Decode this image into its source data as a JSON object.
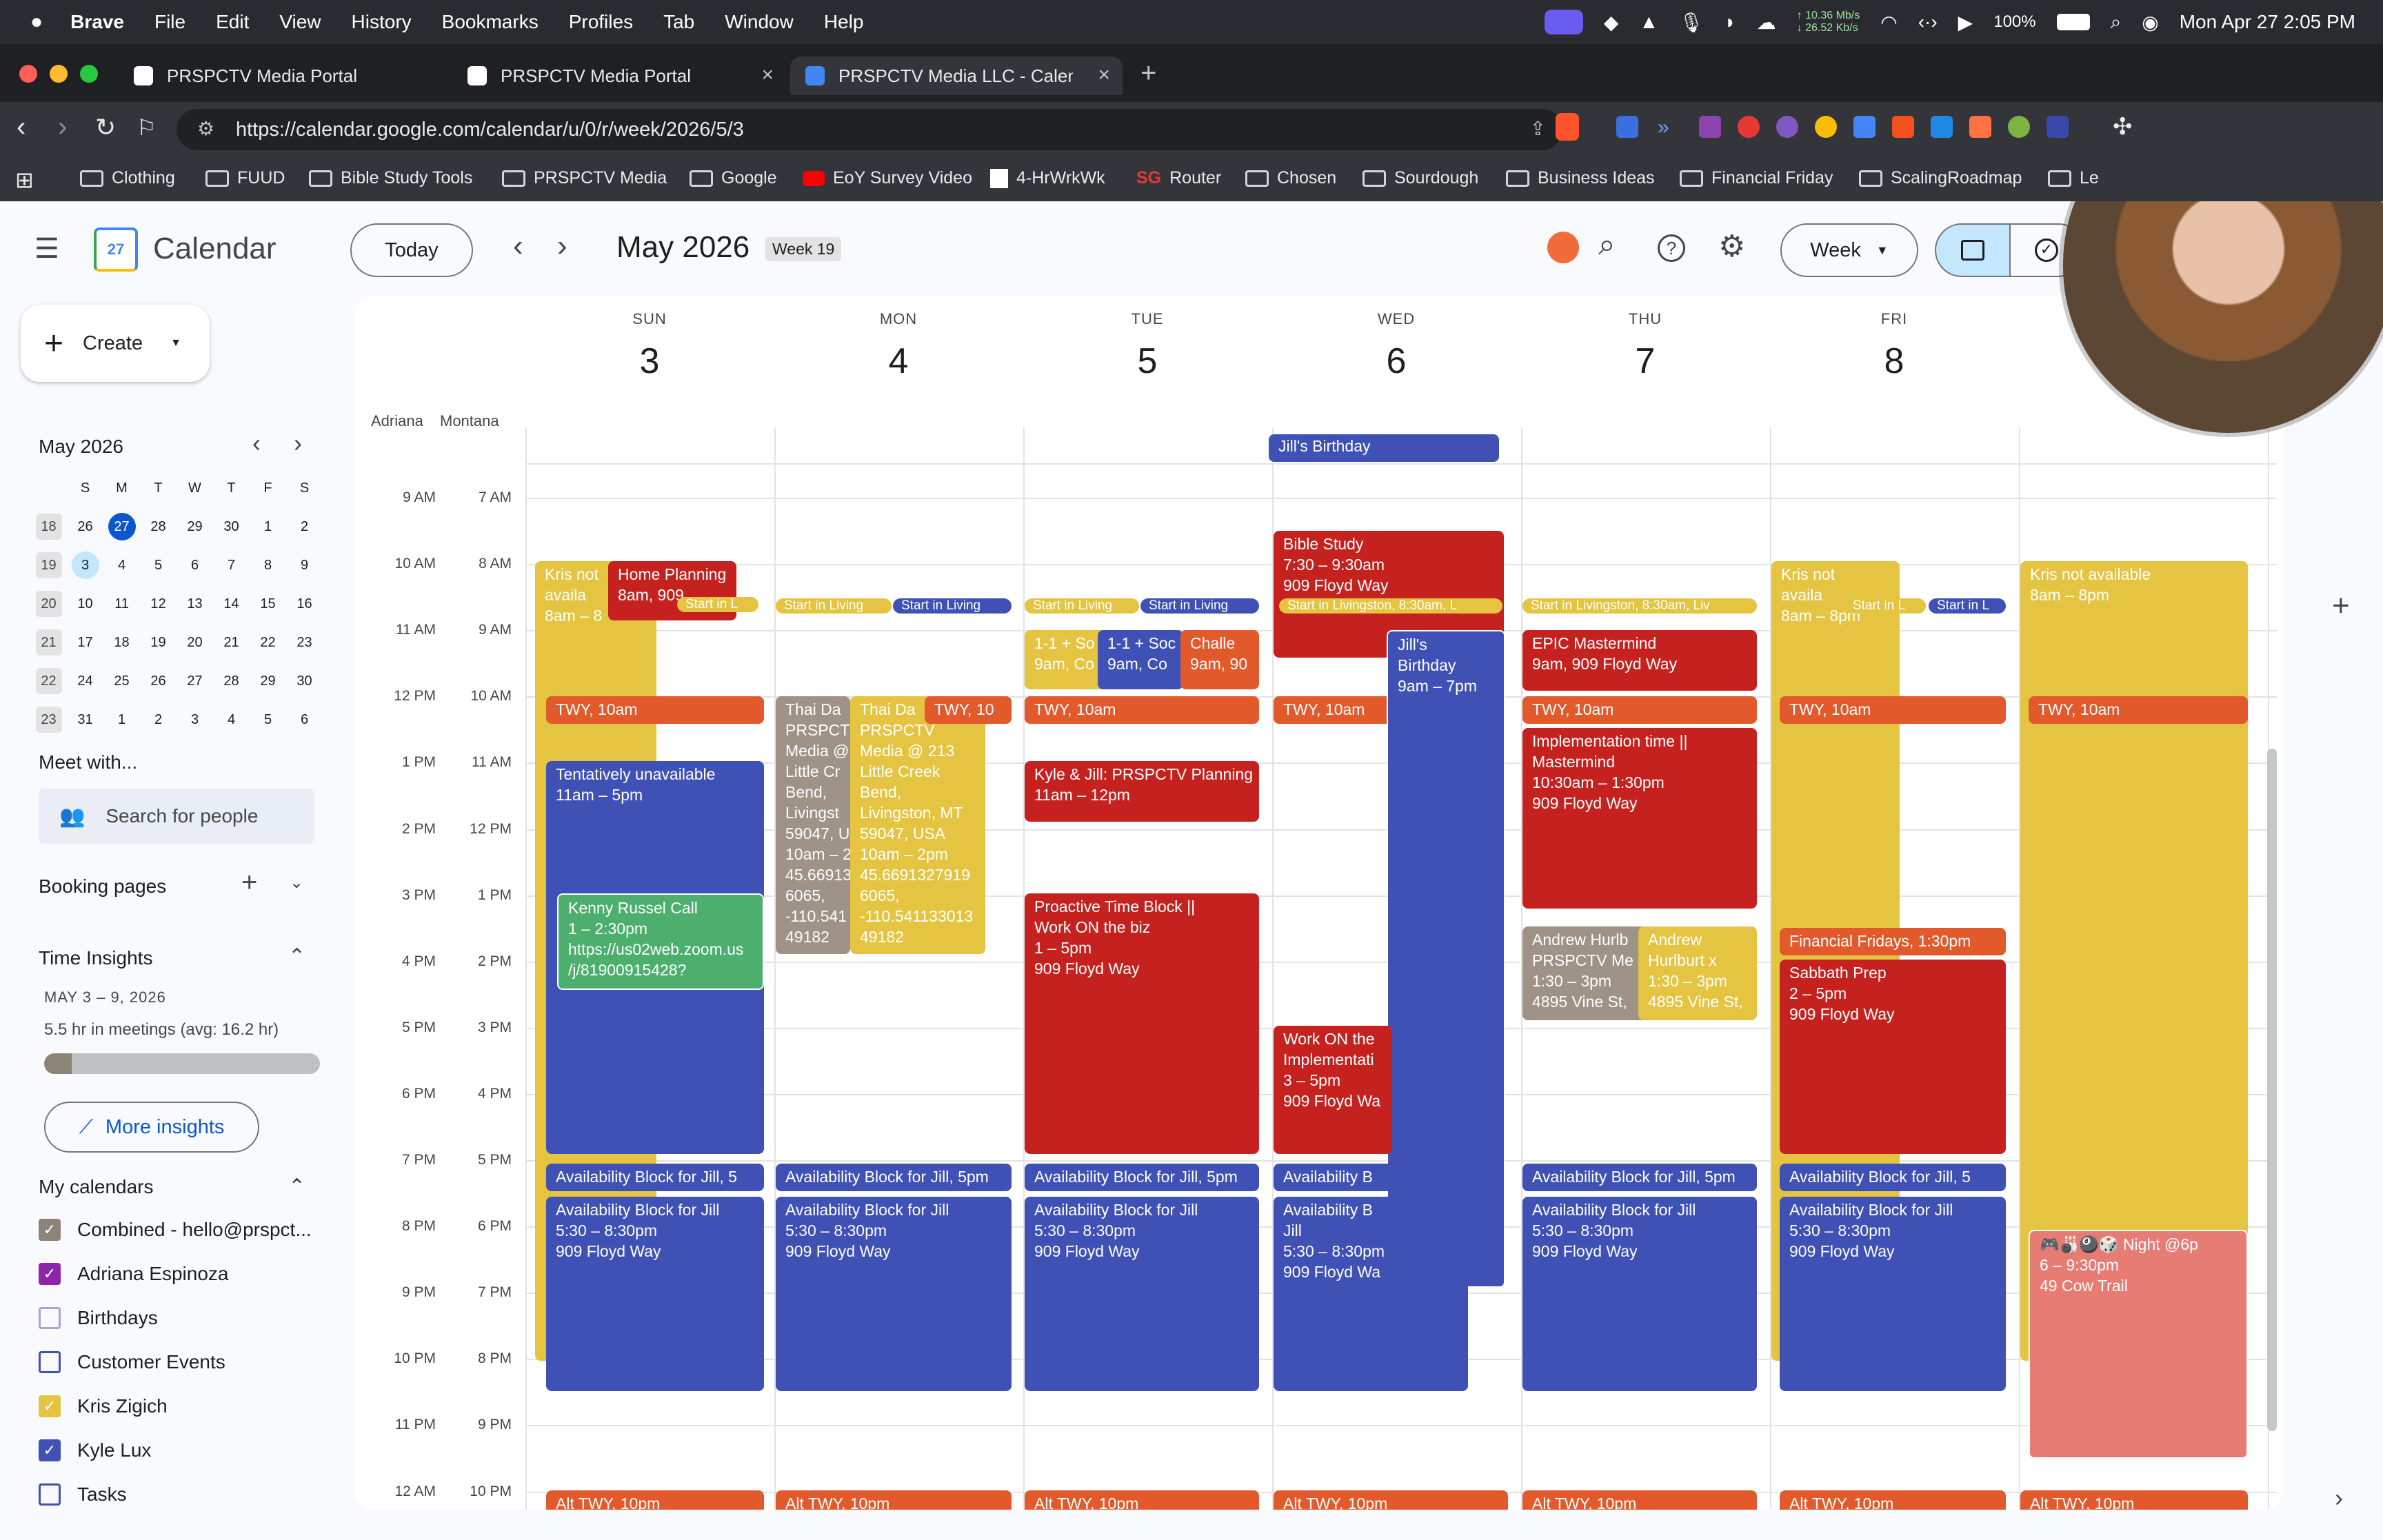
{
  "menubar": {
    "app": "Brave",
    "items": [
      "File",
      "Edit",
      "View",
      "History",
      "Bookmarks",
      "Profiles",
      "Tab",
      "Window",
      "Help"
    ],
    "net_up": "↑ 10.36 Mb/s",
    "net_down": "↓ 26.52 Kb/s",
    "battery": "100%",
    "clock": "Mon Apr 27  2:05 PM"
  },
  "tabs": [
    {
      "title": "PRSPCTV Media Portal"
    },
    {
      "title": "PRSPCTV Media Portal",
      "close": "×"
    },
    {
      "title": "PRSPCTV Media LLC - Calendar",
      "close": "×"
    }
  ],
  "newtab": "+",
  "url": "https://calendar.google.com/calendar/u/0/r/week/2026/5/3",
  "bookmarks": [
    "Clothing",
    "FUUD",
    "Bible Study Tools",
    "PRSPCTV Media",
    "Google",
    "EoY Survey Video",
    "4-HrWrkWk",
    "Router",
    "Chosen",
    "Sourdough",
    "Business Ideas",
    "Financial Friday",
    "ScalingRoadmap",
    "Le"
  ],
  "header": {
    "app_name": "Calendar",
    "logo_day": "27",
    "today": "Today",
    "month": "May 2026",
    "week_badge": "Week 19",
    "view": "Week"
  },
  "sidebar": {
    "create": "Create",
    "mini_month": "May 2026",
    "mini_dow": [
      "S",
      "M",
      "T",
      "W",
      "T",
      "F",
      "S"
    ],
    "mini_rows": [
      {
        "wk": "18",
        "days": [
          "26",
          "27",
          "28",
          "29",
          "30",
          "1",
          "2"
        ]
      },
      {
        "wk": "19",
        "days": [
          "3",
          "4",
          "5",
          "6",
          "7",
          "8",
          "9"
        ]
      },
      {
        "wk": "20",
        "days": [
          "10",
          "11",
          "12",
          "13",
          "14",
          "15",
          "16"
        ]
      },
      {
        "wk": "21",
        "days": [
          "17",
          "18",
          "19",
          "20",
          "21",
          "22",
          "23"
        ]
      },
      {
        "wk": "22",
        "days": [
          "24",
          "25",
          "26",
          "27",
          "28",
          "29",
          "30"
        ]
      },
      {
        "wk": "23",
        "days": [
          "31",
          "1",
          "2",
          "3",
          "4",
          "5",
          "6"
        ]
      }
    ],
    "meet_with": "Meet with...",
    "search_people": "Search for people",
    "booking_pages": "Booking pages",
    "time_insights": "Time Insights",
    "insights_range": "MAY 3 – 9, 2026",
    "insights_summary": "5.5 hr in meetings (avg: 16.2 hr)",
    "insights_fill": 0.1,
    "more_insights": "More insights",
    "my_calendars": "My calendars",
    "calendars": [
      {
        "name": "Combined - hello@prspct...",
        "color": "#8d8478",
        "checked": true
      },
      {
        "name": "Adriana Espinoza",
        "color": "#8e24aa",
        "checked": true
      },
      {
        "name": "Birthdays",
        "color": "#b39ddb",
        "checked": false
      },
      {
        "name": "Customer Events",
        "color": "#3f51b5",
        "checked": false
      },
      {
        "name": "Kris Zigich",
        "color": "#e4c441",
        "checked": true
      },
      {
        "name": "Kyle Lux",
        "color": "#3f51b5",
        "checked": true
      },
      {
        "name": "Tasks",
        "color": "#3f51b5",
        "checked": false
      }
    ]
  },
  "timezones": [
    "Adriana",
    "Montana"
  ],
  "days": [
    {
      "name": "SUN",
      "num": "3"
    },
    {
      "name": "MON",
      "num": "4"
    },
    {
      "name": "TUE",
      "num": "5"
    },
    {
      "name": "WED",
      "num": "6"
    },
    {
      "name": "THU",
      "num": "7"
    },
    {
      "name": "FRI",
      "num": "8"
    }
  ],
  "time_rows": [
    {
      "a": "9 AM",
      "m": "7 AM"
    },
    {
      "a": "10 AM",
      "m": "8 AM"
    },
    {
      "a": "11 AM",
      "m": "9 AM"
    },
    {
      "a": "12 PM",
      "m": "10 AM"
    },
    {
      "a": "1 PM",
      "m": "11 AM"
    },
    {
      "a": "2 PM",
      "m": "12 PM"
    },
    {
      "a": "3 PM",
      "m": "1 PM"
    },
    {
      "a": "4 PM",
      "m": "2 PM"
    },
    {
      "a": "5 PM",
      "m": "3 PM"
    },
    {
      "a": "6 PM",
      "m": "4 PM"
    },
    {
      "a": "7 PM",
      "m": "5 PM"
    },
    {
      "a": "8 PM",
      "m": "6 PM"
    },
    {
      "a": "9 PM",
      "m": "7 PM"
    },
    {
      "a": "10 PM",
      "m": "8 PM"
    },
    {
      "a": "11 PM",
      "m": "9 PM"
    },
    {
      "a": "12 AM",
      "m": "10 PM"
    }
  ],
  "allday": {
    "wed": "Jill's Birthday"
  },
  "events": {
    "sun_kris": [
      "Kris not",
      "availa",
      "8am – 8"
    ],
    "sun_home": [
      "Home Planning",
      "8am, 909"
    ],
    "sun_twy": "TWY, 10am",
    "sun_tent": [
      "Tentatively unavailable",
      "11am – 5pm"
    ],
    "sun_kenny": [
      "Kenny Russel Call",
      "1 – 2:30pm",
      "https://us02web.zoom.us",
      "/j/81900915428?"
    ],
    "sun_avail_short": "Availability Block for Jill, 5",
    "sun_avail": [
      "Availability Block for Jill",
      "5:30 – 8:30pm",
      "909 Floyd Way"
    ],
    "sun_alt": "Alt TWY, 10pm",
    "mon_thai1": [
      "Thai Da",
      "PRSPCTV",
      "Media @",
      "Little Cr",
      "Bend,",
      "Livingst",
      "59047, U",
      "10am – 2",
      "45.66913",
      "6065,",
      "-110.541",
      "49182"
    ],
    "mon_thai2": [
      "Thai Da",
      "PRSPCTV",
      "Media @ 213",
      "Little Creek",
      "Bend,",
      "Livingston, MT",
      "59047, USA",
      "10am – 2pm",
      "45.6691327919",
      "6065,",
      "-110.541133013",
      "49182"
    ],
    "mon_twy": "TWY, 10",
    "mon_avail_short": "Availability Block for Jill, 5pm",
    "mon_avail": [
      "Availability Block for Jill",
      "5:30 – 8:30pm",
      "909 Floyd Way"
    ],
    "mon_alt": "Alt TWY, 10pm",
    "tue_11a": [
      "1-1 + So",
      "9am, Co"
    ],
    "tue_11b": [
      "1-1 + Soc",
      "9am, Co"
    ],
    "tue_chal": [
      "Challe",
      "9am, 90"
    ],
    "tue_twy": "TWY, 10am",
    "tue_kyle": [
      "Kyle & Jill: PRSPCTV Planning",
      "11am – 12pm"
    ],
    "tue_proactive": [
      "Proactive Time Block ||",
      "Work ON the biz",
      "1 – 5pm",
      "909 Floyd Way"
    ],
    "tue_avail_short": "Availability Block for Jill, 5pm",
    "tue_avail": [
      "Availability Block for Jill",
      "5:30 – 8:30pm",
      "909 Floyd Way"
    ],
    "tue_alt": "Alt TWY, 10pm",
    "wed_bible": [
      "Bible Study",
      "7:30 – 9:30am",
      "909 Floyd Way"
    ],
    "wed_twy": "TWY, 10am",
    "wed_bday": [
      "Jill's",
      "Birthday",
      "9am – 7pm"
    ],
    "wed_workon": [
      "Work ON the",
      "Implementati",
      "3 – 5pm",
      "909 Floyd Wa"
    ],
    "wed_avail_short": "Availability B",
    "wed_avail": [
      "Availability B",
      "Jill",
      "5:30 – 8:30pm",
      "909 Floyd Wa"
    ],
    "wed_alt": "Alt TWY, 10pm",
    "thu_epic": [
      "EPIC Mastermind",
      "9am, 909 Floyd Way"
    ],
    "thu_twy": "TWY, 10am",
    "thu_impl": [
      "Implementation time ||",
      "Mastermind",
      "10:30am – 1:30pm",
      "909 Floyd Way"
    ],
    "thu_andrew1": [
      "Andrew Hurlb",
      "PRSPCTV Me",
      "1:30 – 3pm",
      "4895 Vine St,"
    ],
    "thu_andrew2": [
      "Andrew",
      "Hurlburt x",
      "1:30 – 3pm",
      "4895 Vine St,"
    ],
    "thu_avail_short": "Availability Block for Jill, 5pm",
    "thu_avail": [
      "Availability Block for Jill",
      "5:30 – 8:30pm",
      "909 Floyd Way"
    ],
    "thu_alt": "Alt TWY, 10pm",
    "fri_kris": [
      "Kris not",
      "availa",
      "8am – 8pm"
    ],
    "fri_twy": "TWY, 10am",
    "fri_ff": "Financial Fridays, 1:30pm",
    "fri_sabbath": [
      "Sabbath Prep",
      "2 – 5pm",
      "909 Floyd Way"
    ],
    "fri_avail_short": "Availability Block for Jill, 5",
    "fri_avail": [
      "Availability Block for Jill",
      "5:30 – 8:30pm",
      "909 Floyd Way"
    ],
    "fri_alt": "Alt TWY, 10pm",
    "sat_kris": [
      "Kris not available",
      "8am – 8pm"
    ],
    "sat_twy": "TWY, 10am",
    "sat_night": [
      "🎮🎳🎱🎲 Night @6p",
      "6 – 9:30pm",
      "49 Cow Trail"
    ],
    "sat_alt": "Alt TWY, 10pm"
  },
  "chips": {
    "sun": "Start in L",
    "mon1": "Start in Living",
    "mon2": "Start in Living",
    "tue1": "Start in Living",
    "tue2": "Start in Living",
    "wed": "Start in Livingston, 8:30am, L",
    "thu": "Start in Livingston, 8:30am, Liv",
    "fri1": "Start in L",
    "fri2": "Start in L"
  },
  "colors": {
    "accent": "#0b57d0",
    "red": "#c5221f",
    "blue": "#3f51b5",
    "yellow": "#e4c441",
    "orange": "#e25a2c"
  }
}
